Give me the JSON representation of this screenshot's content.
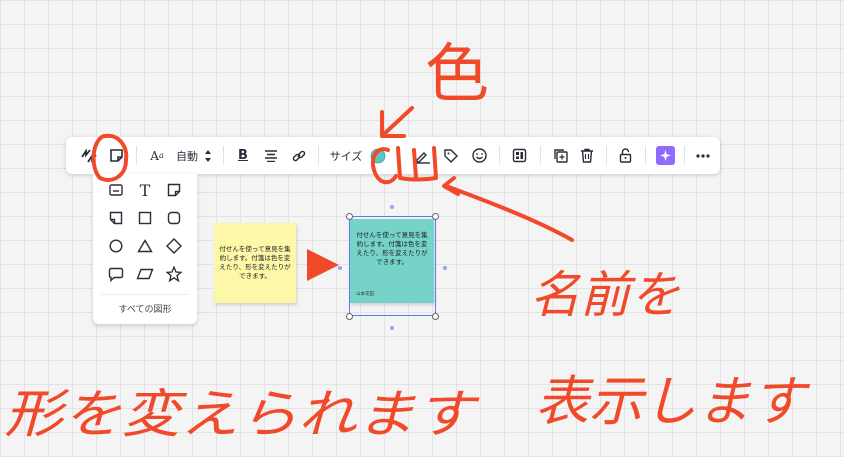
{
  "toolbar": {
    "font_size_label": "自動",
    "size_label": "サイズ",
    "fill_color": "#58c9c0",
    "accent_color": "#8f6cff",
    "icons": [
      "switch-type-icon",
      "sticky-note-icon",
      "font-icon",
      "stepper-icon",
      "bold-icon",
      "align-center-icon",
      "link-icon",
      "color-swatch-icon",
      "author-icon",
      "tag-icon",
      "emoji-icon",
      "layout-icon",
      "duplicate-icon",
      "delete-icon",
      "lock-icon",
      "ai-sparkle-icon",
      "more-icon"
    ]
  },
  "shape_menu": {
    "all_shapes_label": "すべての図形",
    "shapes": [
      "card",
      "text",
      "sticky-note",
      "folded-note",
      "square",
      "rounded-square",
      "circle",
      "triangle",
      "diamond",
      "speech-bubble",
      "parallelogram",
      "star"
    ]
  },
  "canvas": {
    "yellow_note_text": "付せんを使って意見を集約します。付箋は色を変えたり、形を変えたりができます。",
    "teal_note_text": "付せんを使って意見を集約します。付箋は色を変えたり、形を変えたりができます。",
    "teal_note_author": "山本花田",
    "yellow_note_color": "#fdf7a8",
    "teal_note_color": "#76d3c9",
    "arrow_color": "#f04a2a"
  },
  "annotations": {
    "color": "#f04a2a",
    "color_label": "色",
    "author_label": "名前を表示します",
    "shape_label": "形を変えられます"
  }
}
